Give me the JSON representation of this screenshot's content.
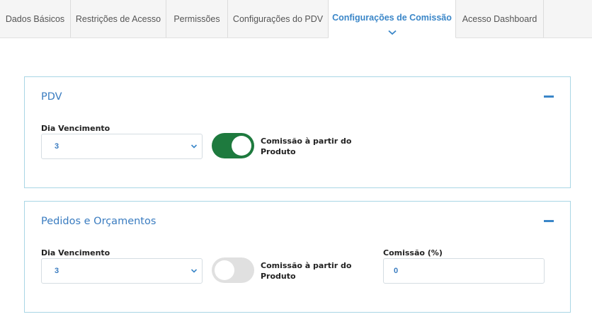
{
  "tabs": [
    {
      "label": "Dados Básicos",
      "active": false
    },
    {
      "label": "Restrições de Acesso",
      "active": false
    },
    {
      "label": "Permissões",
      "active": false
    },
    {
      "label": "Configurações do PDV",
      "active": false
    },
    {
      "label": "Configurações de Comissão",
      "active": true
    },
    {
      "label": "Acesso Dashboard",
      "active": false
    }
  ],
  "pdv": {
    "title": "PDV",
    "dia_vencimento_label": "Dia Vencimento",
    "dia_vencimento_value": "3",
    "comissao_produto_label": "Comissão à partir do Produto",
    "comissao_produto_on": true
  },
  "pedidos": {
    "title": "Pedidos e Orçamentos",
    "dia_vencimento_label": "Dia Vencimento",
    "dia_vencimento_value": "3",
    "comissao_produto_label": "Comissão à partir do Produto",
    "comissao_produto_on": false,
    "comissao_label": "Comissão (%)",
    "comissao_value": "0"
  },
  "colors": {
    "accent": "#3a86c8",
    "toggle_on": "#1e7a3e",
    "toggle_off": "#e0e0e0",
    "panel_border": "#a9d6e5"
  },
  "icons": {
    "active_tab": "chevron-down-icon",
    "collapse": "minus-icon",
    "select": "chevron-down-icon"
  }
}
